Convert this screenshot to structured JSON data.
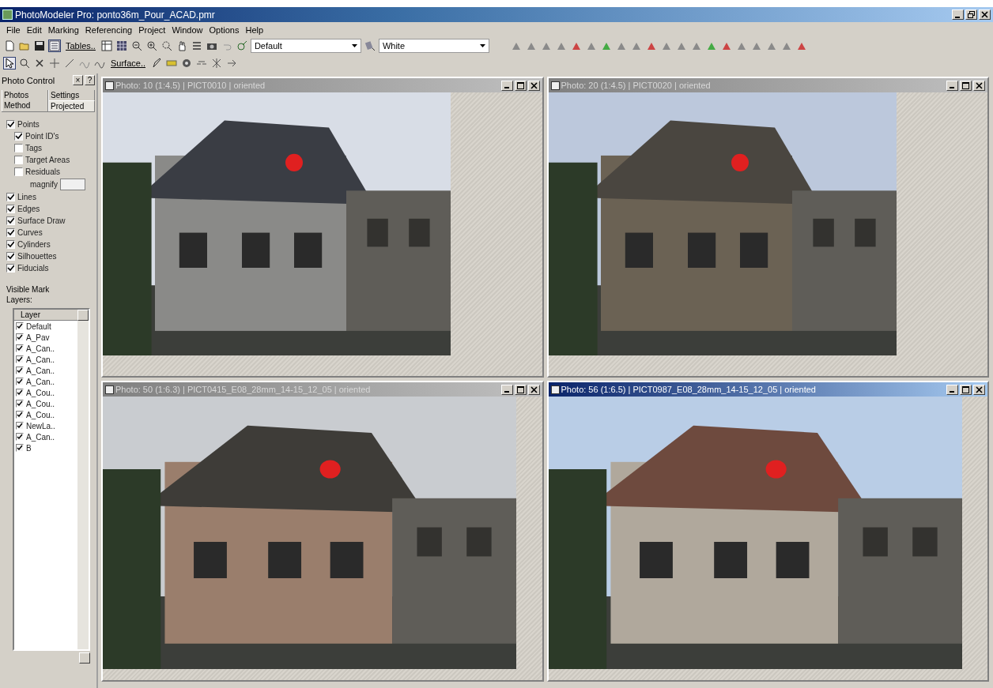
{
  "window": {
    "title": "PhotoModeler Pro: ponto36m_Pour_ACAD.pmr"
  },
  "menu": [
    "File",
    "Edit",
    "Marking",
    "Referencing",
    "Project",
    "Window",
    "Options",
    "Help"
  ],
  "toolbar": {
    "tables_button": "Tables..",
    "style_dropdown": "Default",
    "color_dropdown": "White",
    "surface_button": "Surface.."
  },
  "photo_control": {
    "title": "Photo Control",
    "close": "×",
    "help": "?",
    "tabs": [
      {
        "label": "Photos",
        "selected": false
      },
      {
        "label": "Settings",
        "selected": false
      },
      {
        "label": "Method",
        "selected": false
      },
      {
        "label": "Projected",
        "selected": true
      }
    ],
    "options": [
      {
        "label": "Points",
        "checked": true,
        "children": [
          {
            "label": "Point ID's",
            "checked": true
          },
          {
            "label": "Tags",
            "checked": false
          },
          {
            "label": "Target Areas",
            "checked": false
          },
          {
            "label": "Residuals",
            "checked": false
          }
        ]
      },
      {
        "label": "Lines",
        "checked": true
      },
      {
        "label": "Edges",
        "checked": true
      },
      {
        "label": "Surface Draw",
        "checked": true
      },
      {
        "label": "Curves",
        "checked": true
      },
      {
        "label": "Cylinders",
        "checked": true
      },
      {
        "label": "Silhouettes",
        "checked": true
      },
      {
        "label": "Fiducials",
        "checked": true
      }
    ],
    "magnify_label": "magnify",
    "layers_label": "Visible Mark Layers:",
    "layers_header": "Layer",
    "layers": [
      {
        "label": "Default",
        "checked": true
      },
      {
        "label": "A_Pav",
        "checked": true
      },
      {
        "label": "A_Can..",
        "checked": true
      },
      {
        "label": "A_Can..",
        "checked": true
      },
      {
        "label": "A_Can..",
        "checked": true
      },
      {
        "label": "A_Can..",
        "checked": true
      },
      {
        "label": "A_Cou..",
        "checked": true
      },
      {
        "label": "A_Cou..",
        "checked": true
      },
      {
        "label": "A_Cou..",
        "checked": true
      },
      {
        "label": "NewLa..",
        "checked": true
      },
      {
        "label": "A_Can..",
        "checked": true
      },
      {
        "label": "B",
        "checked": true
      }
    ]
  },
  "photo_windows": [
    {
      "title": "Photo: 10 (1:4.5) | PICT0010 | oriented",
      "selected": false
    },
    {
      "title": "Photo: 20 (1:4.5) | PICT0020 | oriented",
      "selected": false
    },
    {
      "title": "Photo: 50 (1:6.3) | PICT0415_E08_28mm_14-15_12_05 | oriented",
      "selected": false
    },
    {
      "title": "Photo: 56 (1:6.5) | PICT0987_E08_28mm_14-15_12_05 | oriented",
      "selected": true
    }
  ]
}
